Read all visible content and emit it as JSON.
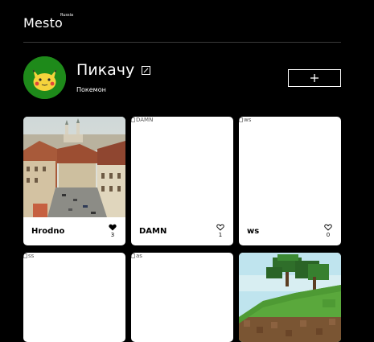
{
  "header": {
    "logo": "Mesto",
    "logo_sup": "Russia"
  },
  "profile": {
    "name": "Пикачу",
    "about": "Покемон",
    "avatar_bg": "#1e8a1a",
    "edit_icon": "pencil-edit-icon",
    "add_icon": "plus-icon"
  },
  "cards": [
    {
      "title": "Hrodno",
      "likes": "3",
      "liked": true,
      "image": "city-photo",
      "alt": ""
    },
    {
      "title": "DAMN",
      "likes": "1",
      "liked": false,
      "image": "broken",
      "alt": "DAMN"
    },
    {
      "title": "ws",
      "likes": "0",
      "liked": false,
      "image": "broken",
      "alt": "ws"
    },
    {
      "title": "",
      "likes": "",
      "liked": false,
      "image": "broken",
      "alt": "ss"
    },
    {
      "title": "",
      "likes": "",
      "liked": false,
      "image": "broken",
      "alt": "as"
    },
    {
      "title": "",
      "likes": "",
      "liked": false,
      "image": "minecraft-landscape",
      "alt": ""
    }
  ]
}
